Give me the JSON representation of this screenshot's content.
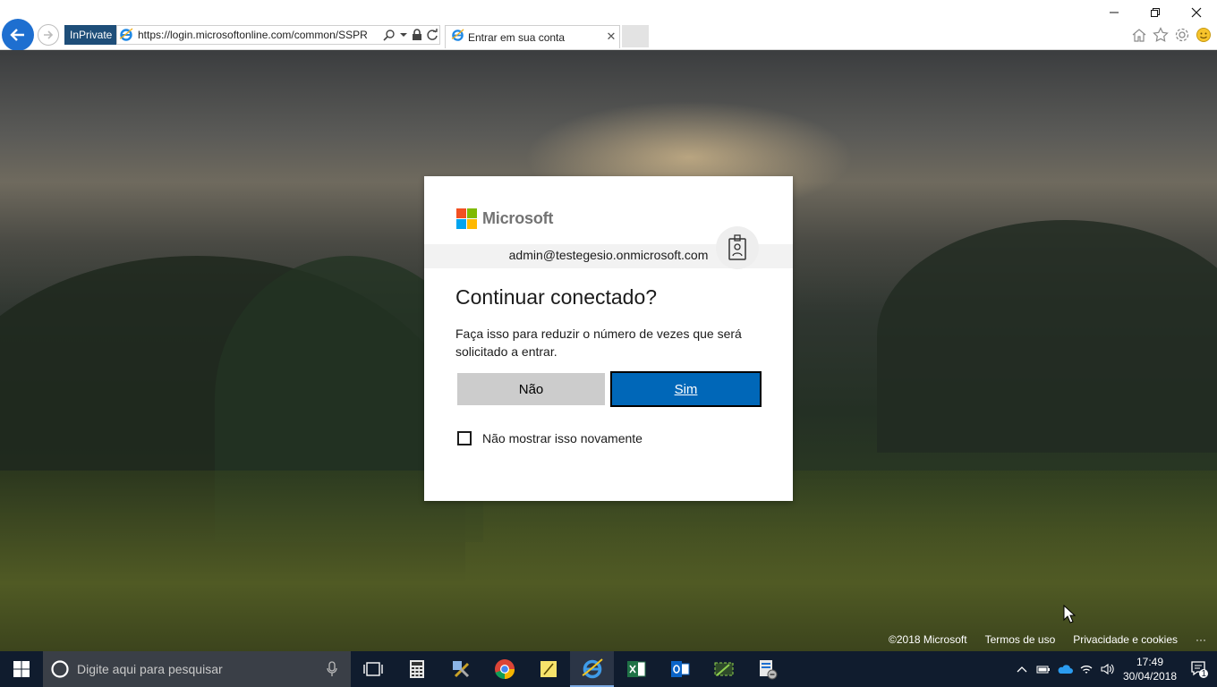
{
  "browser": {
    "inprivate_label": "InPrivate",
    "url": "https://login.microsoftonline.com/common/SSPR",
    "tab_title": "Entrar em sua conta"
  },
  "dialog": {
    "brand": "Microsoft",
    "email": "admin@testegesio.onmicrosoft.com",
    "title": "Continuar conectado?",
    "description": "Faça isso para reduzir o número de vezes que será solicitado a entrar.",
    "no_label": "Não",
    "yes_label": "Sim",
    "checkbox_label": "Não mostrar isso novamente",
    "checkbox_checked": false
  },
  "footer": {
    "copyright": "©2018 Microsoft",
    "terms": "Termos de uso",
    "privacy": "Privacidade e cookies",
    "more": "···"
  },
  "taskbar": {
    "search_placeholder": "Digite aqui para pesquisar",
    "time": "17:49",
    "date": "30/04/2018",
    "notification_count": "1",
    "apps": [
      "task-view",
      "calculator",
      "tools",
      "chrome",
      "sticky-notes",
      "internet-explorer",
      "excel",
      "outlook",
      "snipping",
      "network-tool"
    ]
  },
  "colors": {
    "accent": "#0067b8",
    "taskbar": "#101c2e",
    "secondary_button": "#cccccc"
  }
}
